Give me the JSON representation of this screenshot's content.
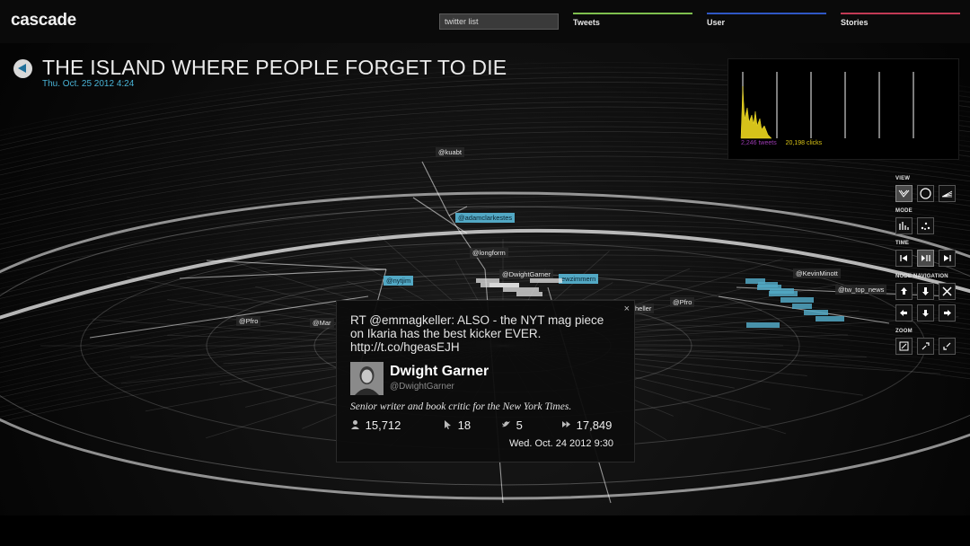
{
  "header": {
    "logo": "cascade",
    "search_value": "twitter list",
    "tabs": [
      {
        "label": "Tweets",
        "color": "#7fbf4e"
      },
      {
        "label": "User",
        "color": "#2f57c4"
      },
      {
        "label": "Stories",
        "color": "#c23a55"
      }
    ]
  },
  "story": {
    "title": "THE ISLAND WHERE PEOPLE FORGET TO DIE",
    "date": "Thu. Oct. 25 2012 4:24"
  },
  "histogram": {
    "tweets_label": "2,246 tweets",
    "clicks_label": "20,198 clicks",
    "tweet_color": "#9a3ab0",
    "clicks_color": "#d9c316"
  },
  "controls": {
    "view_label": "VIEW",
    "mode_label": "MODE",
    "time_label": "TIME",
    "nav_label": "NODE NAVIGATION",
    "zoom_label": "ZOOM"
  },
  "network_labels": [
    {
      "text": "@kuabt",
      "style": "dark"
    },
    {
      "text": "@adamclarkestes",
      "style": "cyan"
    },
    {
      "text": "@longform",
      "style": "dark"
    },
    {
      "text": "@nytjim",
      "style": "cyan"
    },
    {
      "text": "@DwightGarner",
      "style": "dark"
    },
    {
      "text": "ewzimmern",
      "style": "cyan"
    },
    {
      "text": "@Pfro",
      "style": "dark"
    },
    {
      "text": "@Pfro",
      "style": "dark"
    },
    {
      "text": "@KevinMinott",
      "style": "dark"
    },
    {
      "text": "@tw_top_news",
      "style": "dark"
    },
    {
      "text": "heller",
      "style": "dark"
    },
    {
      "text": "@Mar",
      "style": "dark"
    }
  ],
  "tweet": {
    "close": "×",
    "text": "RT @emmagkeller: ALSO - the NYT mag piece on Ikaria has the best kicker EVER. http://t.co/hgeasEJH",
    "name": "Dwight Garner",
    "handle": "@DwightGarner",
    "bio": "Senior writer and book critic for the New York Times.",
    "followers": "15,712",
    "clicks": "18",
    "retweets": "5",
    "reach": "17,849",
    "date": "Wed. Oct. 24 2012 9:30"
  }
}
